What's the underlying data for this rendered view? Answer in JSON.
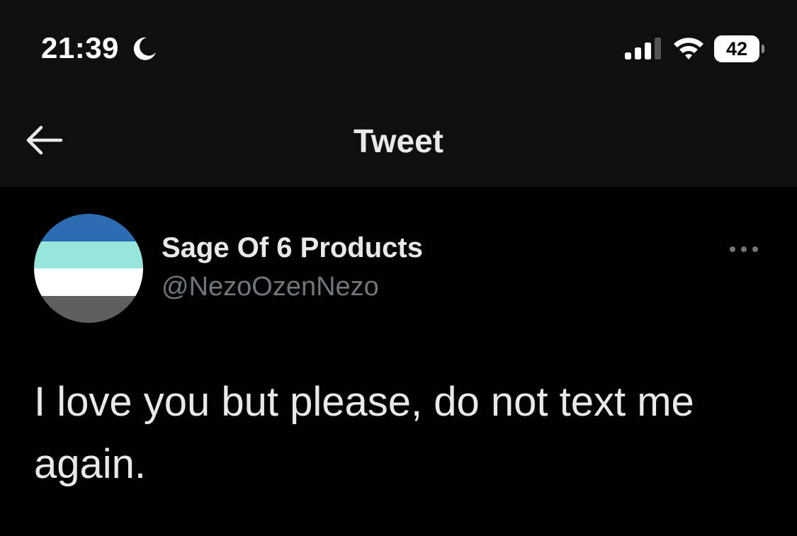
{
  "status_bar": {
    "time": "21:39",
    "battery_level": "42",
    "icons": [
      "moon-icon",
      "signal-icon",
      "wifi-icon",
      "battery-icon"
    ]
  },
  "nav": {
    "title": "Tweet",
    "back_icon": "arrow-left-icon"
  },
  "tweet": {
    "author_name": "Sage Of 6 Products",
    "author_handle": "@NezoOzenNezo",
    "text": "I love you but please, do not text me again.",
    "more_icon": "more-horizontal-icon",
    "avatar_colors": [
      "#2b6cb3",
      "#97e6dc",
      "#ffffff",
      "#5f5f5f"
    ]
  },
  "colors": {
    "background": "#000000",
    "header_background": "#0f0f0f",
    "primary_text": "#e7e9ea",
    "secondary_text": "#71767b"
  }
}
